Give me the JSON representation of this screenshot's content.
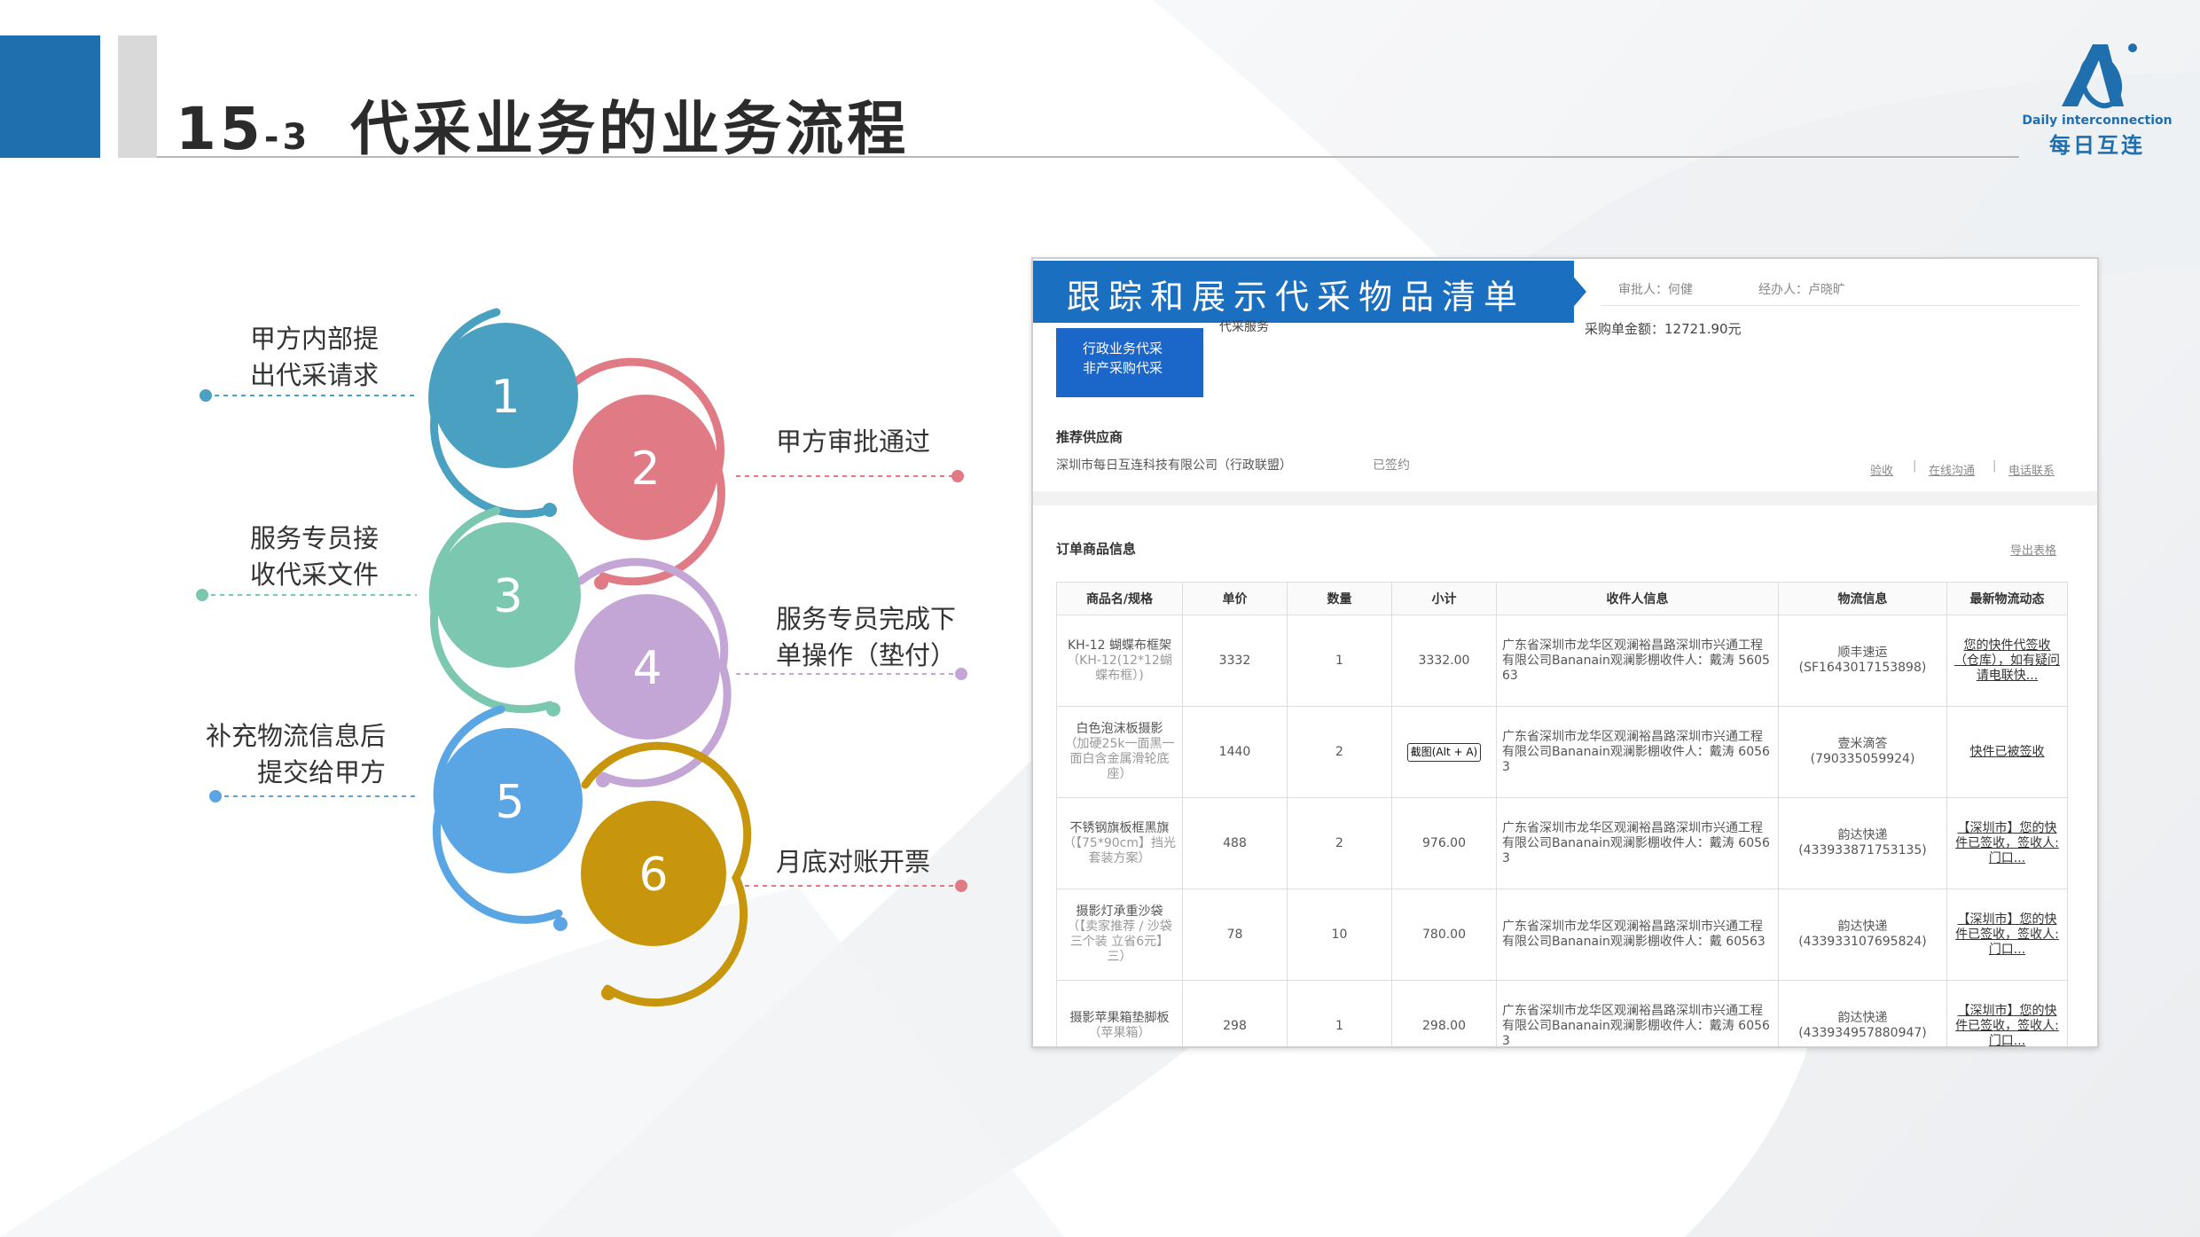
{
  "slide": {
    "title_num": "15",
    "title_sub": "-3",
    "title_text": "代采业务的业务流程"
  },
  "logo": {
    "en": "Daily interconnection",
    "cn": "每日互连"
  },
  "colors": {
    "brand_blue": "#1f6fae",
    "step1": "#4aa0c0",
    "step2": "#e07a85",
    "step3": "#7cc7b0",
    "step4": "#c4a6d6",
    "step5": "#5aa5e3",
    "step6": "#c8960c"
  },
  "steps": [
    {
      "num": "1",
      "label_line1": "甲方内部提",
      "label_line2": "出代采请求"
    },
    {
      "num": "2",
      "label_line1": "甲方审批通过",
      "label_line2": ""
    },
    {
      "num": "3",
      "label_line1": "服务专员接",
      "label_line2": "收代采文件"
    },
    {
      "num": "4",
      "label_line1": "服务专员完成下",
      "label_line2": "单操作（垫付）"
    },
    {
      "num": "5",
      "label_line1": "补充物流信息后",
      "label_line2": "提交给甲方"
    },
    {
      "num": "6",
      "label_line1": "月底对账开票",
      "label_line2": ""
    }
  ],
  "panel": {
    "banner": "跟踪和展示代采物品清单",
    "approver": "审批人：何健",
    "handler": "经办人：卢晓旷",
    "service": "代采服务",
    "amount": "采购单金额：12721.90元",
    "thumb_line1": "行政业务代采",
    "thumb_line2": "非产采购代采",
    "supplier_title": "推荐供应商",
    "supplier_name": "深圳市每日互连科技有限公司（行政联盟）",
    "supplier_status": "已签约",
    "links": [
      "验收",
      "在线沟通",
      "电话联系"
    ],
    "order_title": "订单商品信息",
    "export": "导出表格",
    "headers": [
      "商品名/规格",
      "单价",
      "数量",
      "小计",
      "收件人信息",
      "物流信息",
      "最新物流动态"
    ],
    "rows": [
      {
        "name": "KH-12 蝴蝶布框架",
        "spec": "（KH-12(12*12蝴蝶布框）)",
        "price": "3332",
        "qty": "1",
        "subtotal": "3332.00",
        "addr": "广东省深圳市龙华区观澜裕昌路深圳市兴通工程有限公司Bananain观澜影棚收件人：戴涛 560563",
        "carrier": "顺丰速运",
        "tracking": "(SF1643017153898)",
        "status": "您的快件代签收（仓库），如有疑问请电联快..."
      },
      {
        "name": "白色泡沫板摄影",
        "spec": "（加硬25k一面黑一面白含金属滑轮底座）",
        "price": "1440",
        "qty": "2",
        "subtotal": "截图(Alt + A)",
        "addr": "广东省深圳市龙华区观澜裕昌路深圳市兴通工程有限公司Bananain观澜影棚收件人：戴涛 60563",
        "carrier": "壹米滴答",
        "tracking": "(790335059924)",
        "status": "快件已被签收"
      },
      {
        "name": "不锈钢旗板框黑旗",
        "spec": "（【75*90cm】挡光套装方案）",
        "price": "488",
        "qty": "2",
        "subtotal": "976.00",
        "addr": "广东省深圳市龙华区观澜裕昌路深圳市兴通工程有限公司Bananain观澜影棚收件人：戴涛 60563",
        "carrier": "韵达快递",
        "tracking": "(433933871753135)",
        "status": "【深圳市】您的快件已签收，签收人: 门口..."
      },
      {
        "name": "摄影灯承重沙袋",
        "spec": "（【卖家推荐 / 沙袋三个装 立省6元】三）",
        "price": "78",
        "qty": "10",
        "subtotal": "780.00",
        "addr": "广东省深圳市龙华区观澜裕昌路深圳市兴通工程有限公司Bananain观澜影棚收件人：戴 60563",
        "carrier": "韵达快递",
        "tracking": "(433933107695824)",
        "status": "【深圳市】您的快件已签收，签收人: 门口..."
      },
      {
        "name": "摄影苹果箱垫脚板",
        "spec": "（苹果箱）",
        "price": "298",
        "qty": "1",
        "subtotal": "298.00",
        "addr": "广东省深圳市龙华区观澜裕昌路深圳市兴通工程有限公司Bananain观澜影棚收件人：戴涛 60563",
        "carrier": "韵达快递",
        "tracking": "(433934957880947)",
        "status": "【深圳市】您的快件已签收，签收人: 门口..."
      }
    ]
  }
}
